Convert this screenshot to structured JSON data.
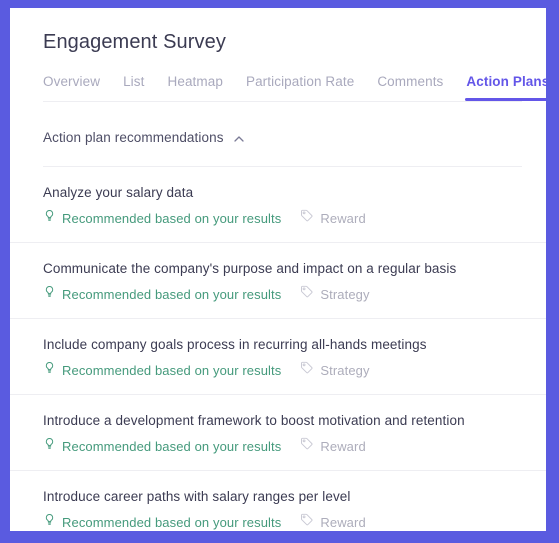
{
  "theme": {
    "frame_color": "#5a5be0",
    "accent_color": "#6356e8",
    "recommended_color": "#459a7c",
    "tag_color": "#adadbb",
    "title_color": "#3b3b52",
    "inactive_tab_color": "#a9a9bd",
    "divider_color": "#eeeef2"
  },
  "header": {
    "title": "Engagement Survey"
  },
  "tabs": [
    {
      "label": "Overview",
      "active": false
    },
    {
      "label": "List",
      "active": false
    },
    {
      "label": "Heatmap",
      "active": false
    },
    {
      "label": "Participation Rate",
      "active": false
    },
    {
      "label": "Comments",
      "active": false
    },
    {
      "label": "Action Plans",
      "active": true
    }
  ],
  "section": {
    "label": "Action plan recommendations",
    "toggle_icon": "chevron-up-icon",
    "expanded": true
  },
  "recommendations": [
    {
      "title": "Analyze your salary data",
      "recommended_label": "Recommended based on your results",
      "recommended_icon": "lightbulb-icon",
      "tag_label": "Reward",
      "tag_icon": "tag-icon"
    },
    {
      "title": "Communicate the company's purpose and impact on a regular basis",
      "recommended_label": "Recommended based on your results",
      "recommended_icon": "lightbulb-icon",
      "tag_label": "Strategy",
      "tag_icon": "tag-icon"
    },
    {
      "title": "Include company goals process in recurring all-hands meetings",
      "recommended_label": "Recommended based on your results",
      "recommended_icon": "lightbulb-icon",
      "tag_label": "Strategy",
      "tag_icon": "tag-icon"
    },
    {
      "title": "Introduce a development framework to boost motivation and retention",
      "recommended_label": "Recommended based on your results",
      "recommended_icon": "lightbulb-icon",
      "tag_label": "Reward",
      "tag_icon": "tag-icon"
    },
    {
      "title": "Introduce career paths with salary ranges per level",
      "recommended_label": "Recommended based on your results",
      "recommended_icon": "lightbulb-icon",
      "tag_label": "Reward",
      "tag_icon": "tag-icon"
    }
  ]
}
